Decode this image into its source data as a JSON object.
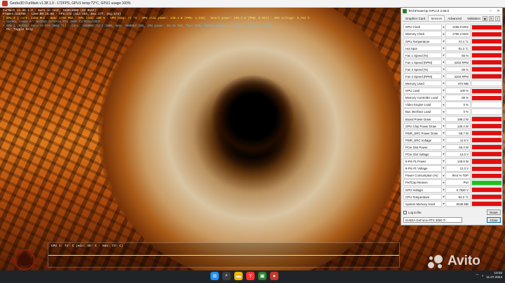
{
  "furmark": {
    "window_title": "Geeks3D FurMark v1.38.1.0 - 172FPS, GPU1 temp:72°C, GPU1 usage:100%",
    "osd": [
      {
        "text": "FurMark v1.38.1.0 - Burn-in test, 1920x1080 (8X MSAA)",
        "color": "#ffffff"
      },
      {
        "text": "Frames:116788 - time:00:15:08 - FPS:172 (min:163, max:177, avg:174)",
        "color": "#ffffff"
      },
      {
        "text": "[ GPU-Z ] core: 1455 MHz - mem: 1750 MHz - GPU load: 100 % - GPU temp: 72 °C - GPU chip power: 130.4 W (PPW: 1.319) - Board power: 199.2 W (PPW: 0.864) - GPU voltage: 0.762 V",
        "color": "#ffe14a"
      },
      {
        "text": "> OpenGL renderer: NVIDIA GeForce RTX 3060 Ti/PCIe/SSE2",
        "color": "#58c7ff"
      },
      {
        "text": "> GPU 1 (NVIDIA GeForce RTX 3060 Ti) - core: 1680MHz:72°C:100%, mem: 7000MHz:19%, GPU power: 99.1% TDP, fan: 65%, limits:[power:1, temp:0, volt:0, OV:0]",
        "color": "#58c7ff"
      },
      {
        "text": "- F1: Toggle help",
        "color": "#ffffff"
      }
    ],
    "graph_label": "GPU 1: 72° C (min: 45° C - max: 73° C)"
  },
  "gpuz": {
    "title": "TechPowerUp GPU-Z 2.59.0",
    "tabs": [
      "Graphics Card",
      "Sensors",
      "Advanced",
      "Validation"
    ],
    "active_tab": "Sensors",
    "sensors": [
      {
        "label": "GPU Clock",
        "value": "1455.0 MHz",
        "level": 0.95,
        "color": "#e01010"
      },
      {
        "label": "Memory Clock",
        "value": "1750.2 MHz",
        "level": 0.95,
        "color": "#e01010"
      },
      {
        "label": "GPU Temperature",
        "value": "72.4 °C",
        "level": 0.95,
        "color": "#e01010"
      },
      {
        "label": "Hot Spot",
        "value": "81.3 °C",
        "level": 0.95,
        "color": "#e01010"
      },
      {
        "label": "Fan 1 Speed (%)",
        "value": "65 %",
        "level": 0.95,
        "color": "#e01010"
      },
      {
        "label": "Fan 1 Speed (RPM)",
        "value": "2203 RPM",
        "level": 0.95,
        "color": "#e01010"
      },
      {
        "label": "Fan 2 Speed (%)",
        "value": "65 %",
        "level": 0.95,
        "color": "#e01010"
      },
      {
        "label": "Fan 2 Speed (RPM)",
        "value": "2203 RPM",
        "level": 0.95,
        "color": "#e01010"
      },
      {
        "label": "Memory Used",
        "value": "872 MB",
        "level": 0.12,
        "color": "#e01010"
      },
      {
        "label": "GPU Load",
        "value": "100 %",
        "level": 0.95,
        "color": "#e01010"
      },
      {
        "label": "Memory Controller Load",
        "value": "86 %",
        "level": 0.85,
        "color": "#e01010"
      },
      {
        "label": "Video Engine Load",
        "value": "0 %",
        "level": 0,
        "color": "#e01010"
      },
      {
        "label": "Bus Interface Load",
        "value": "0 %",
        "level": 0,
        "color": "#e01010"
      },
      {
        "label": "Board Power Draw",
        "value": "199.2 W",
        "level": 0.95,
        "color": "#e01010"
      },
      {
        "label": "GPU Chip Power Draw",
        "value": "130.4 W",
        "level": 0.95,
        "color": "#e01010"
      },
      {
        "label": "PWR_SRC Power Draw",
        "value": "68.7 W",
        "level": 0.95,
        "color": "#e01010"
      },
      {
        "label": "PWR_SRC Voltage",
        "value": "11.9 V",
        "level": 0.95,
        "color": "#e01010"
      },
      {
        "label": "PCIe Slot Power",
        "value": "50.3 W",
        "level": 0.95,
        "color": "#e01010"
      },
      {
        "label": "PCIe Slot Voltage",
        "value": "12.0 V",
        "level": 0.95,
        "color": "#e01010"
      },
      {
        "label": "8-Pin #1 Power",
        "value": "148.9 W",
        "level": 0.95,
        "color": "#e01010"
      },
      {
        "label": "8-Pin #1 Voltage",
        "value": "12.3 V",
        "level": 0.95,
        "color": "#e01010"
      },
      {
        "label": "Power Consumption (%)",
        "value": "99.6 % TDP",
        "level": 0.95,
        "color": "#e01010"
      },
      {
        "label": "PerfCap Reason",
        "value": "Pwr",
        "level": 0.95,
        "color": "#20c020"
      },
      {
        "label": "GPU Voltage",
        "value": "0.7620 V",
        "level": 0.95,
        "color": "#e01010"
      },
      {
        "label": "CPU Temperature",
        "value": "54.0 °C",
        "level": 0.95,
        "color": "#e01010"
      },
      {
        "label": "System Memory Used",
        "value": "8048 MB",
        "level": 0.95,
        "color": "#e01010"
      }
    ],
    "log_label": "Log to file",
    "reset_label": "Reset",
    "gpu_select": "NVIDIA GeForce RTX 3060 Ti",
    "close_label": "Close"
  },
  "taskbar": {
    "apps": [
      {
        "name": "windows-start",
        "glyph": "⊞",
        "color": "#1f8ef1"
      },
      {
        "name": "search",
        "glyph": "⌕",
        "color": "#3a3d42"
      },
      {
        "name": "file-explorer",
        "glyph": "▬",
        "color": "#f0b400"
      },
      {
        "name": "yandex-browser",
        "glyph": "Y",
        "color": "#f33"
      },
      {
        "name": "gpu-z",
        "glyph": "▣",
        "color": "#2e7d32"
      },
      {
        "name": "furmark",
        "glyph": "●",
        "color": "#c0392b"
      }
    ],
    "clock_time": "13:02",
    "clock_date": "11.07.2024"
  },
  "watermark": "Avito"
}
